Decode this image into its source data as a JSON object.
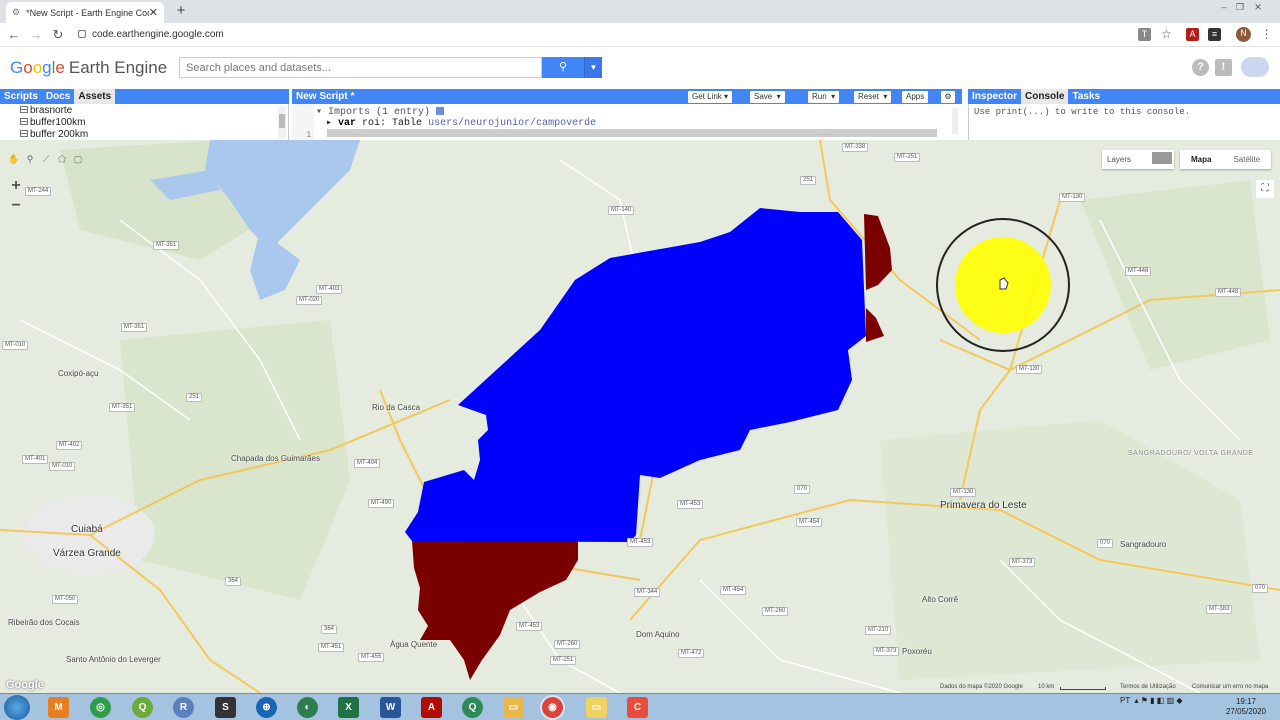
{
  "browser": {
    "tab_title": "*New Script - Earth Engine Code",
    "url": "code.earthengine.google.com"
  },
  "header": {
    "logo_google": "Google",
    "logo_product": "Earth Engine",
    "search_placeholder": "Search places and datasets..."
  },
  "left_panel": {
    "tabs": [
      "Scripts",
      "Docs",
      "Assets"
    ],
    "active_tab": "Assets",
    "assets": [
      "brasnorte",
      "buffer100km",
      "buffer 200km"
    ]
  },
  "editor": {
    "title": "New Script *",
    "buttons": {
      "get_link": "Get Link",
      "save": "Save",
      "run": "Run",
      "reset": "Reset",
      "apps": "Apps"
    },
    "imports_line": "Imports (1 entry)",
    "var_keyword": "var",
    "var_text": " roi: Table ",
    "var_path": "users/neurojunior/campoverde",
    "line_number": "1"
  },
  "right_panel": {
    "tabs": [
      "Inspector",
      "Console",
      "Tasks"
    ],
    "active_tab": "Console",
    "console_text": "Use print(...) to write to this console."
  },
  "map": {
    "layers_label": "Layers",
    "map_types": [
      "Mapa",
      "Satélite"
    ],
    "active_map_type": "Mapa",
    "zoom_in": "+",
    "zoom_out": "−",
    "attribution": "Dados do mapa ©2020 Google",
    "scale": "10 km",
    "terms": "Termos de Utilização",
    "report": "Comunicar um erro no mapa",
    "watermark": "Google",
    "colors": {
      "roi_fill": "#0000ff",
      "buffer_fill": "#7a0000",
      "cursor_highlight": "#ffff00"
    },
    "places": [
      {
        "name": "Coxipó-açu"
      },
      {
        "name": "Rio da Casca"
      },
      {
        "name": "Chapada dos Guimarães"
      },
      {
        "name": "Cuiabá",
        "big": true
      },
      {
        "name": "Várzea Grande",
        "big": true
      },
      {
        "name": "Ribeirão dos Cocais"
      },
      {
        "name": "Santo Antônio do Leverger"
      },
      {
        "name": "Água Quente"
      },
      {
        "name": "Dom Aquino"
      },
      {
        "name": "Alto Corrê"
      },
      {
        "name": "Poxoréu"
      },
      {
        "name": "Primavera do Leste",
        "big": true
      },
      {
        "name": "Sangradouro"
      },
      {
        "name": "SANGRADOURO/ VOLTA GRANDE",
        "region": true
      }
    ],
    "roads": [
      "MT-338",
      "MT-251",
      "MT-244",
      "MT-351",
      "MT-140",
      "MT-403",
      "MT-020",
      "MT-351",
      "MT-010",
      "MT-351",
      "MT-402",
      "MT-401",
      "MT-010",
      "MT-404",
      "MT-130",
      "MT-448",
      "MT-448",
      "MT-130",
      "251",
      "251",
      "364",
      "MT-490",
      "MT-453",
      "MT-453",
      "070",
      "MT-454",
      "MT-130",
      "070",
      "MT-373",
      "070",
      "MT-050",
      "MT-344",
      "MT-454",
      "MT-260",
      "MT-383",
      "MT-455",
      "MT-451",
      "MT-453",
      "MT-260",
      "MT-472",
      "MT-210",
      "MT-373",
      "364",
      "MT-251"
    ]
  },
  "taskbar": {
    "lang": "PT",
    "time": "19:17",
    "date": "27/05/2020",
    "apps": [
      "matlab-icon",
      "atom-icon",
      "qgis-icon",
      "r-icon",
      "snap-icon",
      "browser-icon",
      "globe-icon",
      "excel-icon",
      "word-icon",
      "acrobat-icon",
      "search-app-icon",
      "folder-icon",
      "chrome-icon",
      "folder-icon",
      "app-icon"
    ]
  }
}
